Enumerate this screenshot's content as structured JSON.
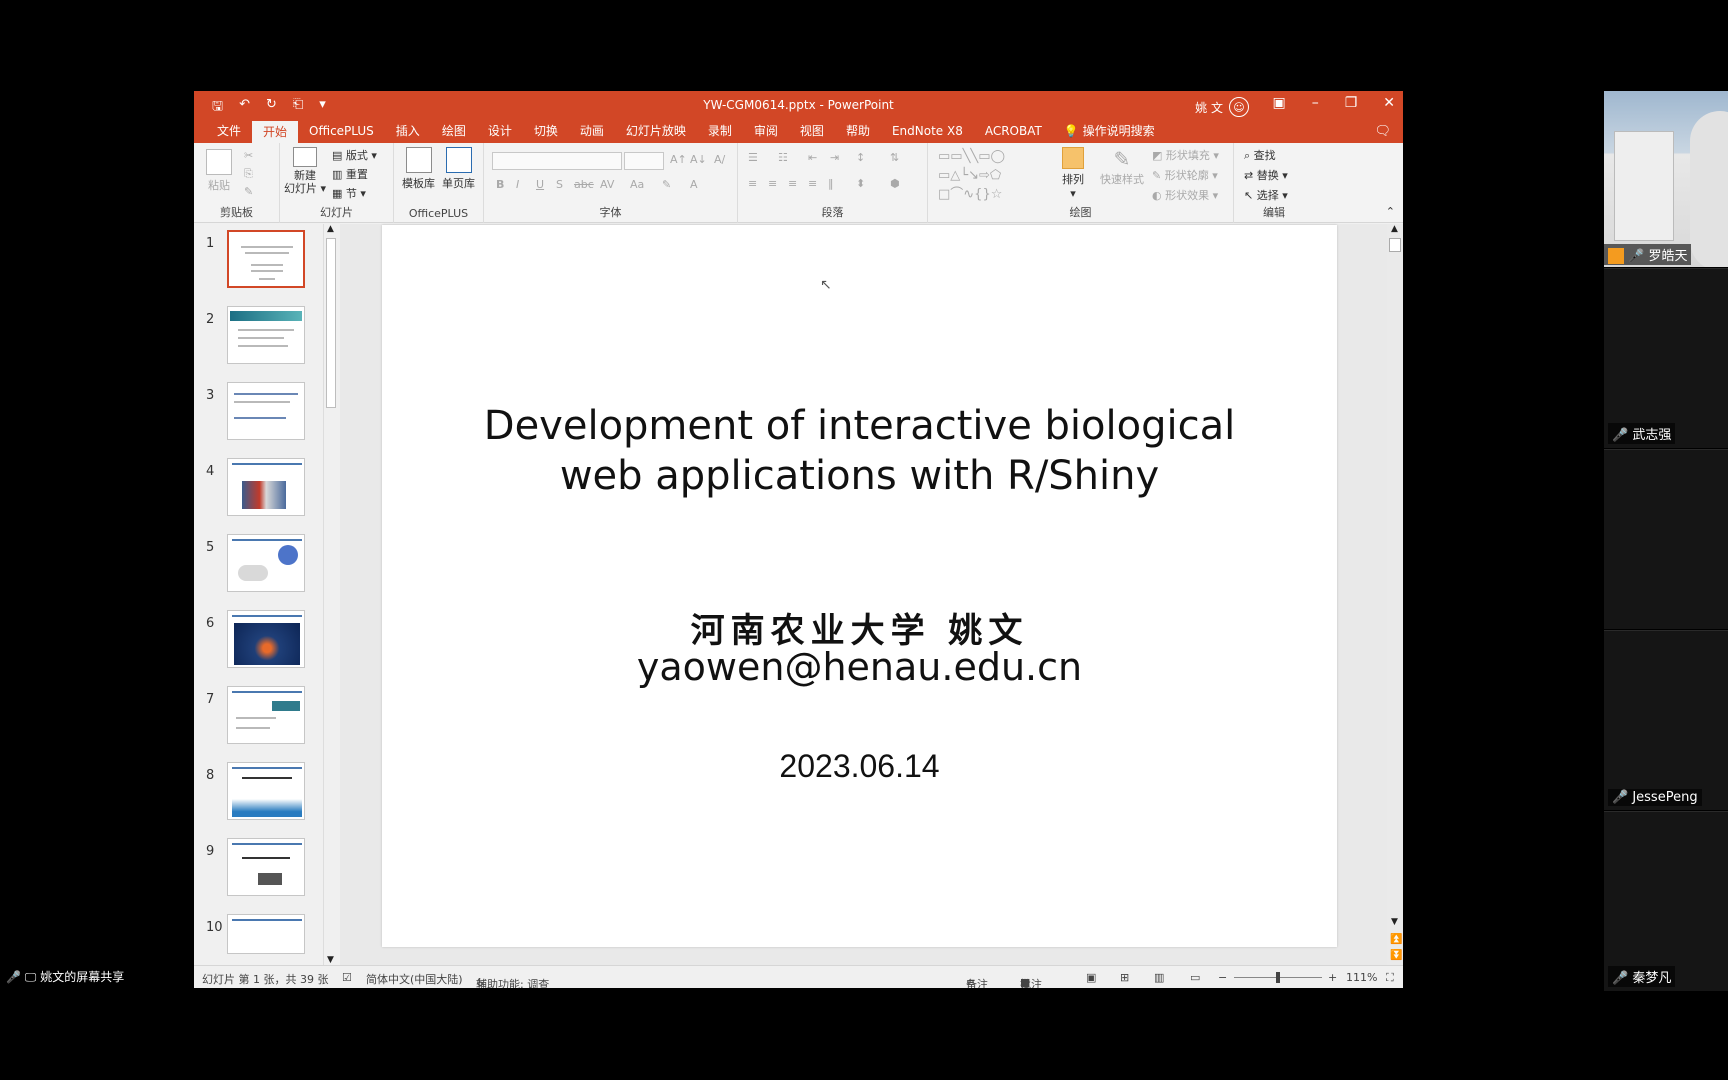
{
  "window": {
    "title": "YW-CGM0614.pptx - PowerPoint",
    "user_name": "姚 文"
  },
  "menu": {
    "tabs": [
      "文件",
      "开始",
      "OfficePLUS",
      "插入",
      "绘图",
      "设计",
      "切换",
      "动画",
      "幻灯片放映",
      "录制",
      "审阅",
      "视图",
      "帮助",
      "EndNote X8",
      "ACROBAT"
    ],
    "search_label": "操作说明搜索",
    "active_tab": "开始"
  },
  "ribbon": {
    "paste": "粘贴",
    "new_slide_1": "新建",
    "new_slide_2": "幻灯片",
    "layout": "版式",
    "reset": "重置",
    "section": "节",
    "template_lib": "模板库",
    "single_page_lib": "单页库",
    "arrange": "排列",
    "quick_styles": "快速样式",
    "shape_fill": "形状填充",
    "shape_outline": "形状轮廓",
    "shape_effects": "形状效果",
    "find": "查找",
    "replace": "替换",
    "select": "选择",
    "groups": {
      "clipboard": "剪贴板",
      "slides": "幻灯片",
      "officeplus": "OfficePLUS",
      "font": "字体",
      "paragraph": "段落",
      "drawing": "绘图",
      "editing": "编辑"
    }
  },
  "thumbnails": [
    "1",
    "2",
    "3",
    "4",
    "5",
    "6",
    "7",
    "8",
    "9",
    "10"
  ],
  "slide": {
    "title_line1": "Development of interactive biological",
    "title_line2": "web applications with R/Shiny",
    "author": "河南农业大学  姚文",
    "email": "yaowen@henau.edu.cn",
    "date": "2023.06.14"
  },
  "status": {
    "slide_info": "幻灯片 第 1 张，共 39 张",
    "language": "简体中文(中国大陆)",
    "accessibility": "辅助功能: 调查",
    "notes": "备注",
    "comments": "批注",
    "zoom": "111%"
  },
  "participants": [
    "罗皓天",
    "武志强",
    "JessePeng",
    "秦梦凡"
  ],
  "screen_share_label": "姚文的屏幕共享"
}
